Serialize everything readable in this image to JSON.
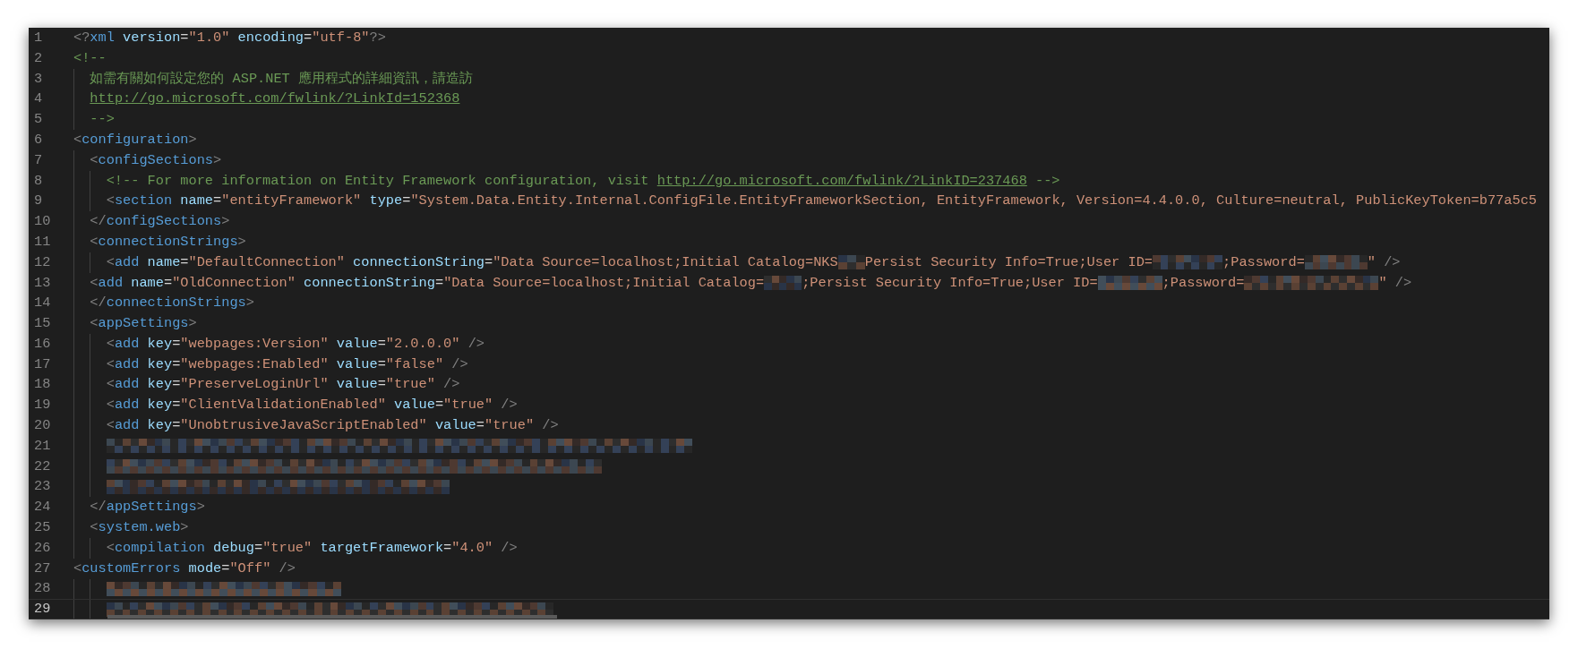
{
  "editor": {
    "lines": [
      {
        "number": "1",
        "current": false,
        "kind": "flat",
        "tokens": [
          {
            "kind": "punct",
            "text": "<?"
          },
          {
            "kind": "tag",
            "text": "xml"
          },
          {
            "kind": "attr",
            "text": " version"
          },
          {
            "kind": "eq",
            "text": "="
          },
          {
            "kind": "string",
            "text": "\"1.0\""
          },
          {
            "kind": "attr",
            "text": " encoding"
          },
          {
            "kind": "eq",
            "text": "="
          },
          {
            "kind": "string",
            "text": "\"utf-8\""
          },
          {
            "kind": "punct",
            "text": "?>"
          }
        ]
      },
      {
        "number": "2",
        "current": false,
        "kind": "flat",
        "tokens": [
          {
            "kind": "comment",
            "text": "<!--"
          }
        ]
      },
      {
        "number": "3",
        "current": false,
        "kind": "inner",
        "tokens": [
          {
            "kind": "comment",
            "text": "如需有關如何設定您的 ASP.NET 應用程式的詳細資訊，請造訪"
          }
        ]
      },
      {
        "number": "4",
        "current": false,
        "kind": "inner",
        "tokens": [
          {
            "kind": "link",
            "text": "http://go.microsoft.com/fwlink/?LinkId=152368"
          }
        ]
      },
      {
        "number": "5",
        "current": false,
        "kind": "inner",
        "tokens": [
          {
            "kind": "comment",
            "text": "-->"
          }
        ]
      },
      {
        "number": "6",
        "current": false,
        "kind": "flat",
        "tokens": [
          {
            "kind": "punct",
            "text": "<"
          },
          {
            "kind": "tag",
            "text": "configuration"
          },
          {
            "kind": "punct",
            "text": ">"
          }
        ]
      },
      {
        "number": "7",
        "current": false,
        "kind": "inner",
        "tokens": [
          {
            "kind": "punct",
            "text": "<"
          },
          {
            "kind": "tag",
            "text": "configSections"
          },
          {
            "kind": "punct",
            "text": ">"
          }
        ]
      },
      {
        "number": "8",
        "current": false,
        "kind": "deep",
        "tokens": [
          {
            "kind": "comment",
            "text": "<!-- For more information on Entity Framework configuration, visit "
          },
          {
            "kind": "link",
            "text": "http://go.microsoft.com/fwlink/?LinkID=237468"
          },
          {
            "kind": "comment",
            "text": " -->"
          }
        ]
      },
      {
        "number": "9",
        "current": false,
        "kind": "deep",
        "tokens": [
          {
            "kind": "punct",
            "text": "<"
          },
          {
            "kind": "tag",
            "text": "section"
          },
          {
            "kind": "attr",
            "text": " name"
          },
          {
            "kind": "eq",
            "text": "="
          },
          {
            "kind": "string",
            "text": "\"entityFramework\""
          },
          {
            "kind": "attr",
            "text": " type"
          },
          {
            "kind": "eq",
            "text": "="
          },
          {
            "kind": "string",
            "text": "\"System.Data.Entity.Internal.ConfigFile.EntityFrameworkSection, EntityFramework, Version=4.4.0.0, Culture=neutral, PublicKeyToken=b77a5c5"
          }
        ]
      },
      {
        "number": "10",
        "current": false,
        "kind": "inner",
        "tokens": [
          {
            "kind": "punct",
            "text": "</"
          },
          {
            "kind": "tag",
            "text": "configSections"
          },
          {
            "kind": "punct",
            "text": ">"
          }
        ]
      },
      {
        "number": "11",
        "current": false,
        "kind": "inner",
        "tokens": [
          {
            "kind": "punct",
            "text": "<"
          },
          {
            "kind": "tag",
            "text": "connectionStrings"
          },
          {
            "kind": "punct",
            "text": ">"
          }
        ]
      },
      {
        "number": "12",
        "current": false,
        "kind": "deep",
        "tokens": [
          {
            "kind": "punct",
            "text": "<"
          },
          {
            "kind": "tag",
            "text": "add"
          },
          {
            "kind": "attr",
            "text": " name"
          },
          {
            "kind": "eq",
            "text": "="
          },
          {
            "kind": "string",
            "text": "\"DefaultConnection\""
          },
          {
            "kind": "attr",
            "text": " connectionString"
          },
          {
            "kind": "eq",
            "text": "="
          },
          {
            "kind": "string",
            "text": "\"Data Source=localhost;Initial Catalog=NKS"
          },
          {
            "kind": "redacted"
          },
          {
            "kind": "string",
            "text": "Persist Security Info=True;User ID="
          },
          {
            "kind": "redacted"
          },
          {
            "kind": "string",
            "text": ";Password="
          },
          {
            "kind": "redacted"
          },
          {
            "kind": "string",
            "text": "\""
          },
          {
            "kind": "punct",
            "text": " />"
          }
        ]
      },
      {
        "number": "13",
        "current": false,
        "kind": "inner",
        "tokens": [
          {
            "kind": "punct",
            "text": "<"
          },
          {
            "kind": "tag",
            "text": "add"
          },
          {
            "kind": "attr",
            "text": " name"
          },
          {
            "kind": "eq",
            "text": "="
          },
          {
            "kind": "string",
            "text": "\"OldConnection\""
          },
          {
            "kind": "attr",
            "text": " connectionString"
          },
          {
            "kind": "eq",
            "text": "="
          },
          {
            "kind": "string",
            "text": "\"Data Source=localhost;Initial Catalog="
          },
          {
            "kind": "redacted"
          },
          {
            "kind": "string",
            "text": ";Persist Security Info=True;User ID="
          },
          {
            "kind": "redacted"
          },
          {
            "kind": "string",
            "text": ";Password="
          },
          {
            "kind": "redacted"
          },
          {
            "kind": "string",
            "text": "\""
          },
          {
            "kind": "punct",
            "text": " />"
          }
        ]
      },
      {
        "number": "14",
        "current": false,
        "kind": "inner",
        "tokens": [
          {
            "kind": "punct",
            "text": "</"
          },
          {
            "kind": "tag",
            "text": "connectionStrings"
          },
          {
            "kind": "punct",
            "text": ">"
          }
        ]
      },
      {
        "number": "15",
        "current": false,
        "kind": "inner",
        "tokens": [
          {
            "kind": "punct",
            "text": "<"
          },
          {
            "kind": "tag",
            "text": "appSettings"
          },
          {
            "kind": "punct",
            "text": ">"
          }
        ]
      },
      {
        "number": "16",
        "current": false,
        "kind": "deep",
        "tokens": [
          {
            "kind": "punct",
            "text": "<"
          },
          {
            "kind": "tag",
            "text": "add"
          },
          {
            "kind": "attr",
            "text": " key"
          },
          {
            "kind": "eq",
            "text": "="
          },
          {
            "kind": "string",
            "text": "\"webpages:Version\""
          },
          {
            "kind": "attr",
            "text": " value"
          },
          {
            "kind": "eq",
            "text": "="
          },
          {
            "kind": "string",
            "text": "\"2.0.0.0\""
          },
          {
            "kind": "punct",
            "text": " />"
          }
        ]
      },
      {
        "number": "17",
        "current": false,
        "kind": "deep",
        "tokens": [
          {
            "kind": "punct",
            "text": "<"
          },
          {
            "kind": "tag",
            "text": "add"
          },
          {
            "kind": "attr",
            "text": " key"
          },
          {
            "kind": "eq",
            "text": "="
          },
          {
            "kind": "string",
            "text": "\"webpages:Enabled\""
          },
          {
            "kind": "attr",
            "text": " value"
          },
          {
            "kind": "eq",
            "text": "="
          },
          {
            "kind": "string",
            "text": "\"false\""
          },
          {
            "kind": "punct",
            "text": " />"
          }
        ]
      },
      {
        "number": "18",
        "current": false,
        "kind": "deep",
        "tokens": [
          {
            "kind": "punct",
            "text": "<"
          },
          {
            "kind": "tag",
            "text": "add"
          },
          {
            "kind": "attr",
            "text": " key"
          },
          {
            "kind": "eq",
            "text": "="
          },
          {
            "kind": "string",
            "text": "\"PreserveLoginUrl\""
          },
          {
            "kind": "attr",
            "text": " value"
          },
          {
            "kind": "eq",
            "text": "="
          },
          {
            "kind": "string",
            "text": "\"true\""
          },
          {
            "kind": "punct",
            "text": " />"
          }
        ]
      },
      {
        "number": "19",
        "current": false,
        "kind": "deep",
        "tokens": [
          {
            "kind": "punct",
            "text": "<"
          },
          {
            "kind": "tag",
            "text": "add"
          },
          {
            "kind": "attr",
            "text": " key"
          },
          {
            "kind": "eq",
            "text": "="
          },
          {
            "kind": "string",
            "text": "\"ClientValidationEnabled\""
          },
          {
            "kind": "attr",
            "text": " value"
          },
          {
            "kind": "eq",
            "text": "="
          },
          {
            "kind": "string",
            "text": "\"true\""
          },
          {
            "kind": "punct",
            "text": " />"
          }
        ]
      },
      {
        "number": "20",
        "current": false,
        "kind": "deep",
        "tokens": [
          {
            "kind": "punct",
            "text": "<"
          },
          {
            "kind": "tag",
            "text": "add"
          },
          {
            "kind": "attr",
            "text": " key"
          },
          {
            "kind": "eq",
            "text": "="
          },
          {
            "kind": "string",
            "text": "\"UnobtrusiveJavaScriptEnabled\""
          },
          {
            "kind": "attr",
            "text": " value"
          },
          {
            "kind": "eq",
            "text": "="
          },
          {
            "kind": "string",
            "text": "\"true\""
          },
          {
            "kind": "punct",
            "text": " />"
          }
        ]
      },
      {
        "number": "21",
        "current": false,
        "kind": "deep",
        "tokens": [
          {
            "kind": "redacted"
          }
        ]
      },
      {
        "number": "22",
        "current": false,
        "kind": "deep",
        "tokens": [
          {
            "kind": "redacted"
          }
        ]
      },
      {
        "number": "23",
        "current": false,
        "kind": "deep",
        "tokens": [
          {
            "kind": "redacted"
          }
        ]
      },
      {
        "number": "24",
        "current": false,
        "kind": "inner",
        "tokens": [
          {
            "kind": "punct",
            "text": "</"
          },
          {
            "kind": "tag",
            "text": "appSettings"
          },
          {
            "kind": "punct",
            "text": ">"
          }
        ]
      },
      {
        "number": "25",
        "current": false,
        "kind": "inner",
        "tokens": [
          {
            "kind": "punct",
            "text": "<"
          },
          {
            "kind": "tag",
            "text": "system.web"
          },
          {
            "kind": "punct",
            "text": ">"
          }
        ]
      },
      {
        "number": "26",
        "current": false,
        "kind": "deep",
        "tokens": [
          {
            "kind": "punct",
            "text": "<"
          },
          {
            "kind": "tag",
            "text": "compilation"
          },
          {
            "kind": "attr",
            "text": " debug"
          },
          {
            "kind": "eq",
            "text": "="
          },
          {
            "kind": "string",
            "text": "\"true\""
          },
          {
            "kind": "attr",
            "text": " targetFramework"
          },
          {
            "kind": "eq",
            "text": "="
          },
          {
            "kind": "string",
            "text": "\"4.0\""
          },
          {
            "kind": "punct",
            "text": " />"
          }
        ]
      },
      {
        "number": "27",
        "current": false,
        "kind": "flat",
        "tokens": [
          {
            "kind": "punct",
            "text": "<"
          },
          {
            "kind": "tag",
            "text": "customErrors"
          },
          {
            "kind": "attr",
            "text": " mode"
          },
          {
            "kind": "eq",
            "text": "="
          },
          {
            "kind": "string",
            "text": "\"Off\""
          },
          {
            "kind": "punct",
            "text": " />"
          }
        ]
      },
      {
        "number": "28",
        "current": false,
        "kind": "deep",
        "tokens": [
          {
            "kind": "redacted"
          }
        ]
      },
      {
        "number": "29",
        "current": true,
        "kind": "deep",
        "tokens": [
          {
            "kind": "redacted"
          }
        ]
      }
    ]
  }
}
